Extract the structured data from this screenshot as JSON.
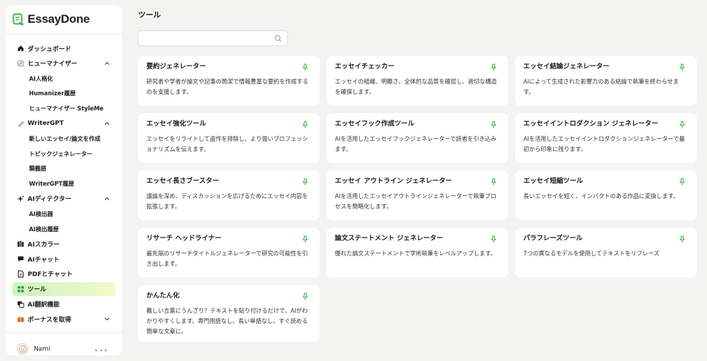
{
  "app": {
    "brand_name": "EssayDone"
  },
  "sidebar": {
    "items": [
      {
        "label": "ダッシュボード"
      },
      {
        "label": "ヒューマナイザー"
      },
      {
        "label": "AI人格化"
      },
      {
        "label": "Humanizer履歴"
      },
      {
        "label": "ヒューマナイザー StyleMe"
      },
      {
        "label": "WriterGPT"
      },
      {
        "label": "新しいエッセイ/論文を作成"
      },
      {
        "label": "トピックジェネレーター"
      },
      {
        "label": "類義語"
      },
      {
        "label": "WriterGPT履歴"
      },
      {
        "label": "AIディテクター"
      },
      {
        "label": "AI検出器"
      },
      {
        "label": "AI検出履歴"
      },
      {
        "label": "AIスカラー"
      },
      {
        "label": "AIチャット"
      },
      {
        "label": "PDFとチャット"
      },
      {
        "label": "ツール"
      },
      {
        "label": "AI翻訳機能"
      },
      {
        "label": "ボーナスを取得"
      }
    ],
    "user": {
      "name": "Nami"
    }
  },
  "main": {
    "title": "ツール",
    "search": {
      "placeholder": "",
      "value": ""
    },
    "tools": [
      {
        "title": "要約ジェネレーター",
        "desc": "研究者や学者が論文や記事の簡潔で情報豊富な要約を作成するのを支援します。"
      },
      {
        "title": "エッセイチェッカー",
        "desc": "エッセイの組織、明瞭さ、全体的な品質を確認し、適切な構造を確保します。"
      },
      {
        "title": "エッセイ結論ジェネレーター",
        "desc": "AIによって生成された影響力のある結論で執筆を終わらせます。"
      },
      {
        "title": "エッセイ強化ツール",
        "desc": "エッセイをリライトして盗作を排除し、より強いプロフェッショナリズムを伝えます。"
      },
      {
        "title": "エッセイフック作成ツール",
        "desc": "AIを活用したエッセイフックジェネレーターで読者を引き込みます。"
      },
      {
        "title": "エッセイイントロダクション ジェネレーター",
        "desc": "AIを活用したエッセイイントロダクションジェネレーターで最初から印象に残ります。"
      },
      {
        "title": "エッセイ長さブースター",
        "desc": "議論を深め、ディスカッションを広げるためにエッセイ内容を拡張します。"
      },
      {
        "title": "エッセイ アウトライン ジェネレーター",
        "desc": "AIを活用したエッセイアウトラインジェネレーターで執筆プロセスを簡略化します。"
      },
      {
        "title": "エッセイ短縮ツール",
        "desc": "長いエッセイを短く、インパクトのある作品に変換します。"
      },
      {
        "title": "リサーチ ヘッドライナー",
        "desc": "最先端のリサーチタイトルジェネレーターで研究の可能性を引き出します。"
      },
      {
        "title": "論文ステートメント ジェネレーター",
        "desc": "優れた論文ステートメントで学術執筆をレベルアップします。"
      },
      {
        "title": "パラフレーズツール",
        "desc": "7つの異なるモデルを使用してテキストをリフレーズ"
      },
      {
        "title": "かんたん化",
        "desc": "難しい言葉にうんざり？テキストを貼り付けるだけで、AIがわかりやすくします。専門用語なし。長い単語なし。すぐ読める簡単な文章に。"
      }
    ]
  },
  "colors": {
    "accent": "#3cb34a",
    "active_bg_start": "#cdf3c3",
    "active_bg_end": "#f1f9c8"
  },
  "icons": {
    "pin": "pin-icon",
    "search": "search-icon"
  }
}
